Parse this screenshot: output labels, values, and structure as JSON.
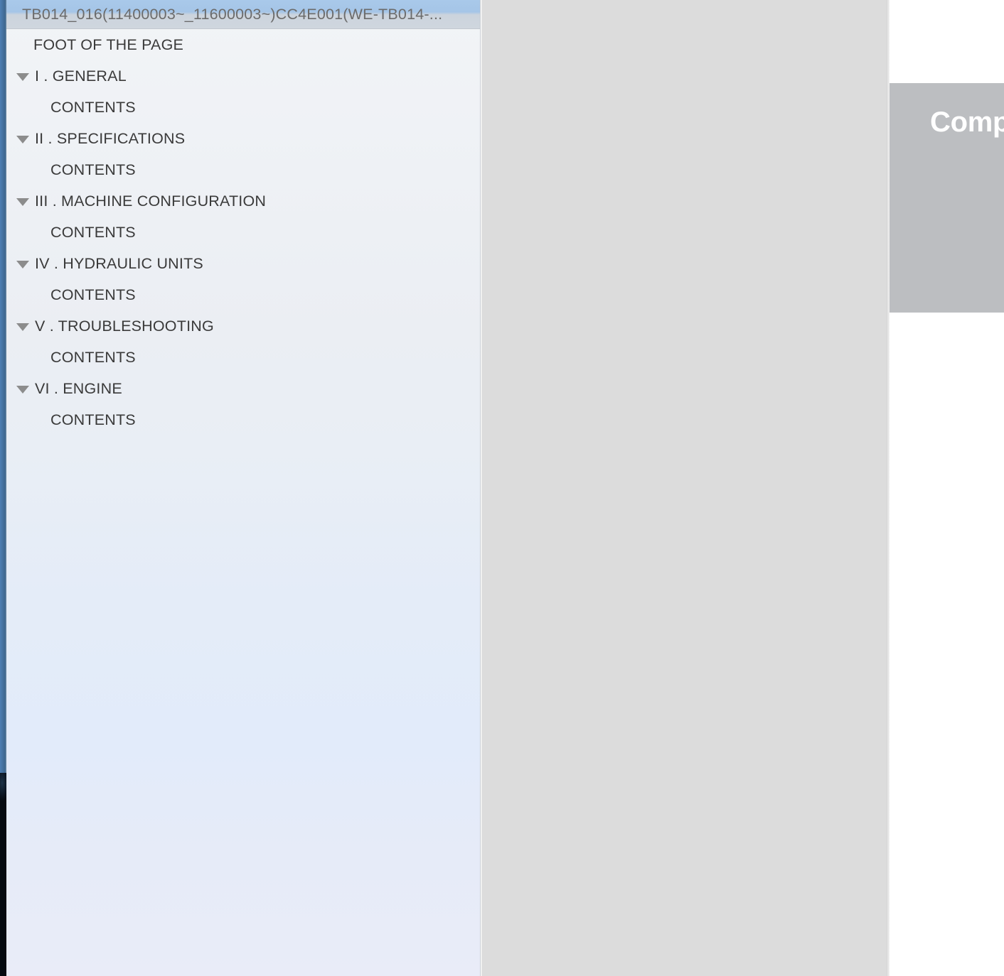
{
  "sidebar": {
    "name": "document-outline-tree",
    "selected_index": 0,
    "items": [
      {
        "label": "TB014_016(11400003~_11600003~)CC4E001(WE-TB014-...",
        "level": "selected",
        "expandable": false,
        "expanded": false
      },
      {
        "label": "FOOT OF THE PAGE",
        "level": "sub",
        "expandable": false,
        "expanded": false
      },
      {
        "label": "I . GENERAL",
        "level": "chapter",
        "expandable": true,
        "expanded": true
      },
      {
        "label": "CONTENTS",
        "level": "leaf",
        "expandable": false,
        "expanded": false
      },
      {
        "label": "II . SPECIFICATIONS",
        "level": "chapter",
        "expandable": true,
        "expanded": true
      },
      {
        "label": "CONTENTS",
        "level": "leaf",
        "expandable": false,
        "expanded": false
      },
      {
        "label": "III . MACHINE CONFIGURATION",
        "level": "chapter",
        "expandable": true,
        "expanded": true
      },
      {
        "label": "CONTENTS",
        "level": "leaf",
        "expandable": false,
        "expanded": false
      },
      {
        "label": "IV . HYDRAULIC UNITS",
        "level": "chapter",
        "expandable": true,
        "expanded": true
      },
      {
        "label": "CONTENTS",
        "level": "leaf",
        "expandable": false,
        "expanded": false
      },
      {
        "label": "V . TROUBLESHOOTING",
        "level": "chapter",
        "expandable": true,
        "expanded": true
      },
      {
        "label": "CONTENTS",
        "level": "leaf",
        "expandable": false,
        "expanded": false
      },
      {
        "label": "VI . ENGINE",
        "level": "chapter",
        "expandable": true,
        "expanded": true
      },
      {
        "label": "CONTENTS",
        "level": "leaf",
        "expandable": false,
        "expanded": false
      }
    ]
  },
  "document_viewport": {
    "name": "document-page-area",
    "page_background": "#dcdcdc"
  },
  "right_panel": {
    "promo_card": {
      "title": "Compa",
      "background": "#bcbec1",
      "title_color": "#ffffff"
    }
  },
  "colors": {
    "selection_blue": "#a9c9ea",
    "rail_blue": "#45719f",
    "sidebar_top": "#f2f4f7",
    "sidebar_bottom": "#e2ebfa",
    "page_gray": "#dcdcdc",
    "text": "#3a3a3a",
    "selected_text": "#6b6b6b",
    "disclosure_gray": "#8c8c8c"
  }
}
